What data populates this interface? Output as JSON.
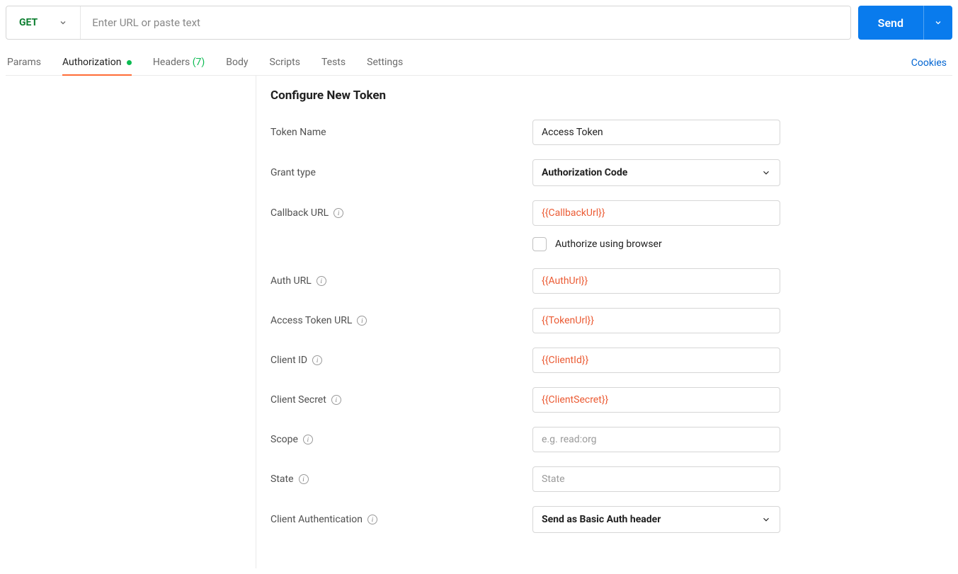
{
  "request": {
    "method": "GET",
    "url_placeholder": "Enter URL or paste text",
    "send_label": "Send"
  },
  "tabs": {
    "params": "Params",
    "authorization": "Authorization",
    "headers": "Headers",
    "headers_count": "(7)",
    "body": "Body",
    "scripts": "Scripts",
    "tests": "Tests",
    "settings": "Settings"
  },
  "cookies_label": "Cookies",
  "form": {
    "title": "Configure New Token",
    "token_name_label": "Token Name",
    "token_name_value": "Access Token",
    "grant_type_label": "Grant type",
    "grant_type_value": "Authorization Code",
    "callback_url_label": "Callback URL",
    "callback_url_value": "{{CallbackUrl}}",
    "authorize_browser_label": "Authorize using browser",
    "auth_url_label": "Auth URL",
    "auth_url_value": "{{AuthUrl}}",
    "access_token_url_label": "Access Token URL",
    "access_token_url_value": "{{TokenUrl}}",
    "client_id_label": "Client ID",
    "client_id_value": "{{ClientId}}",
    "client_secret_label": "Client Secret",
    "client_secret_value": "{{ClientSecret}}",
    "scope_label": "Scope",
    "scope_placeholder": "e.g. read:org",
    "state_label": "State",
    "state_placeholder": "State",
    "client_auth_label": "Client Authentication",
    "client_auth_value": "Send as Basic Auth header"
  }
}
